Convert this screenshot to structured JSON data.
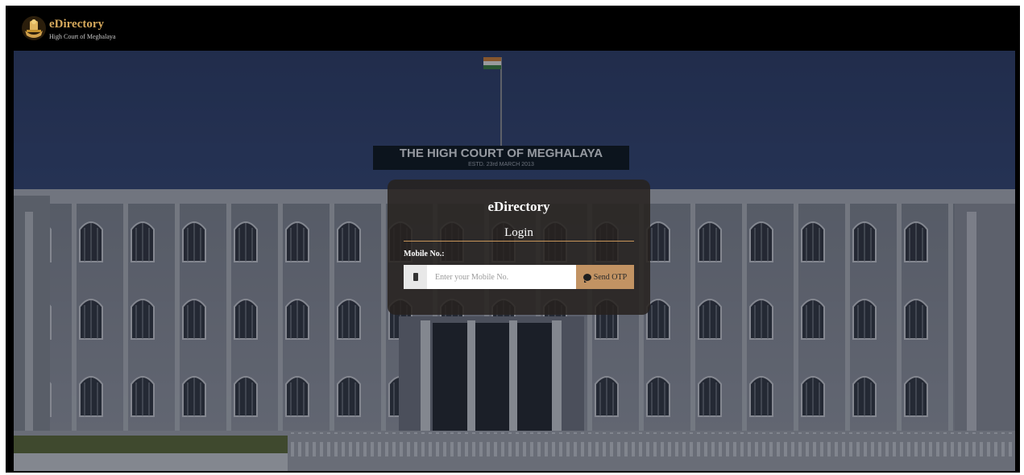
{
  "header": {
    "app_title": "eDirectory",
    "subtitle": "High Court of Meghalaya",
    "logo_icon": "emblem-icon"
  },
  "background": {
    "building_sign_line1": "THE HIGH COURT OF MEGHALAYA",
    "building_sign_line2": "ESTD. 23rd MARCH 2013"
  },
  "login_card": {
    "title": "eDirectory",
    "subtitle": "Login",
    "mobile_label": "Mobile No.:",
    "mobile_placeholder": "Enter your Mobile No.",
    "mobile_value": "",
    "send_otp_label": "Send OTP",
    "phone_icon": "phone-icon",
    "otp_icon": "chat-bubble-icon"
  },
  "colors": {
    "accent": "#c29363",
    "brand_gold": "#d6a95c",
    "card_bg": "#26221e"
  }
}
